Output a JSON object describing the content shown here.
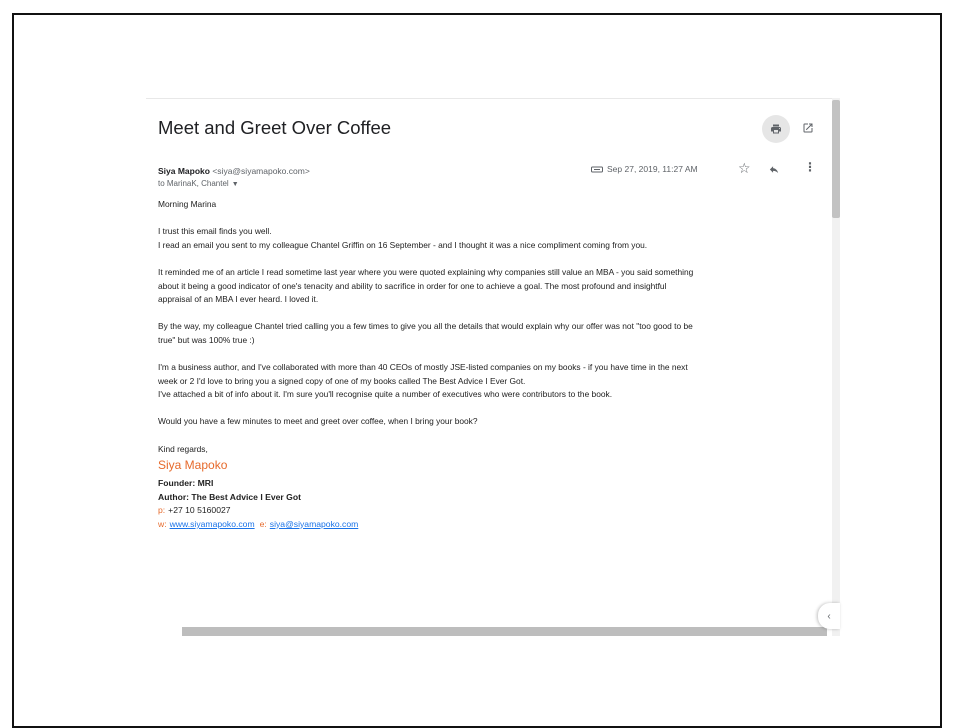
{
  "email": {
    "subject": "Meet and Greet Over Coffee",
    "sender_name": "Siya Mapoko",
    "sender_email": "<siya@siyamapoko.com>",
    "recipients": "to MarinaK, Chantel",
    "date": "Sep 27, 2019, 11:27 AM",
    "icons": [
      "print-icon",
      "popout-icon",
      "attachment-icon",
      "star-icon",
      "reply-icon",
      "more-icon",
      "chevron-left-icon"
    ]
  },
  "body": {
    "greeting": "Morning Marina",
    "p1_l1": "I trust this email finds you well.",
    "p1_l2": "I read an email you sent to my colleague Chantel Griffin on 16 September - and I thought it was a nice compliment coming from you.",
    "p2_l1": "It reminded me of an article I read sometime last year where you were quoted explaining why companies still value an MBA - you said something",
    "p2_l2": "about it being a good indicator of one's tenacity and ability to sacrifice in order for one to achieve a goal. The most profound and insightful",
    "p2_l3": "appraisal of an MBA I ever heard. I loved it.",
    "p3_l1": "By the way, my colleague Chantel tried calling you a few times to give you all the details that would explain why our offer was not \"too good to be",
    "p3_l2": "true\" but was 100% true :)",
    "p4_l1": "I'm a business author, and I've collaborated with more than 40 CEOs of mostly JSE-listed companies on my books - if you have time in the next",
    "p4_l2": "week or 2 I'd love to bring you a signed copy of one of my books called The Best Advice I Ever Got.",
    "p4_l3": "I've attached a bit of info about it. I'm sure you'll recognise quite a number of executives who were contributors to the book.",
    "p5": "Would you have a few minutes to meet and greet over coffee, when I bring your book?",
    "closing": "Kind regards,"
  },
  "signature": {
    "name": "Siya Mapoko",
    "title1": "Founder: MRI",
    "title2": "Author: The Best Advice I Ever Got",
    "phone_label": "p:",
    "phone": "+27 10 5160027",
    "web_label": "w:",
    "web": "www.siyamapoko.com",
    "email_label": "e:",
    "email": "siya@siyamapoko.com"
  },
  "colors": {
    "accent_orange": "#e66a2c",
    "link_blue": "#1a73e8"
  }
}
